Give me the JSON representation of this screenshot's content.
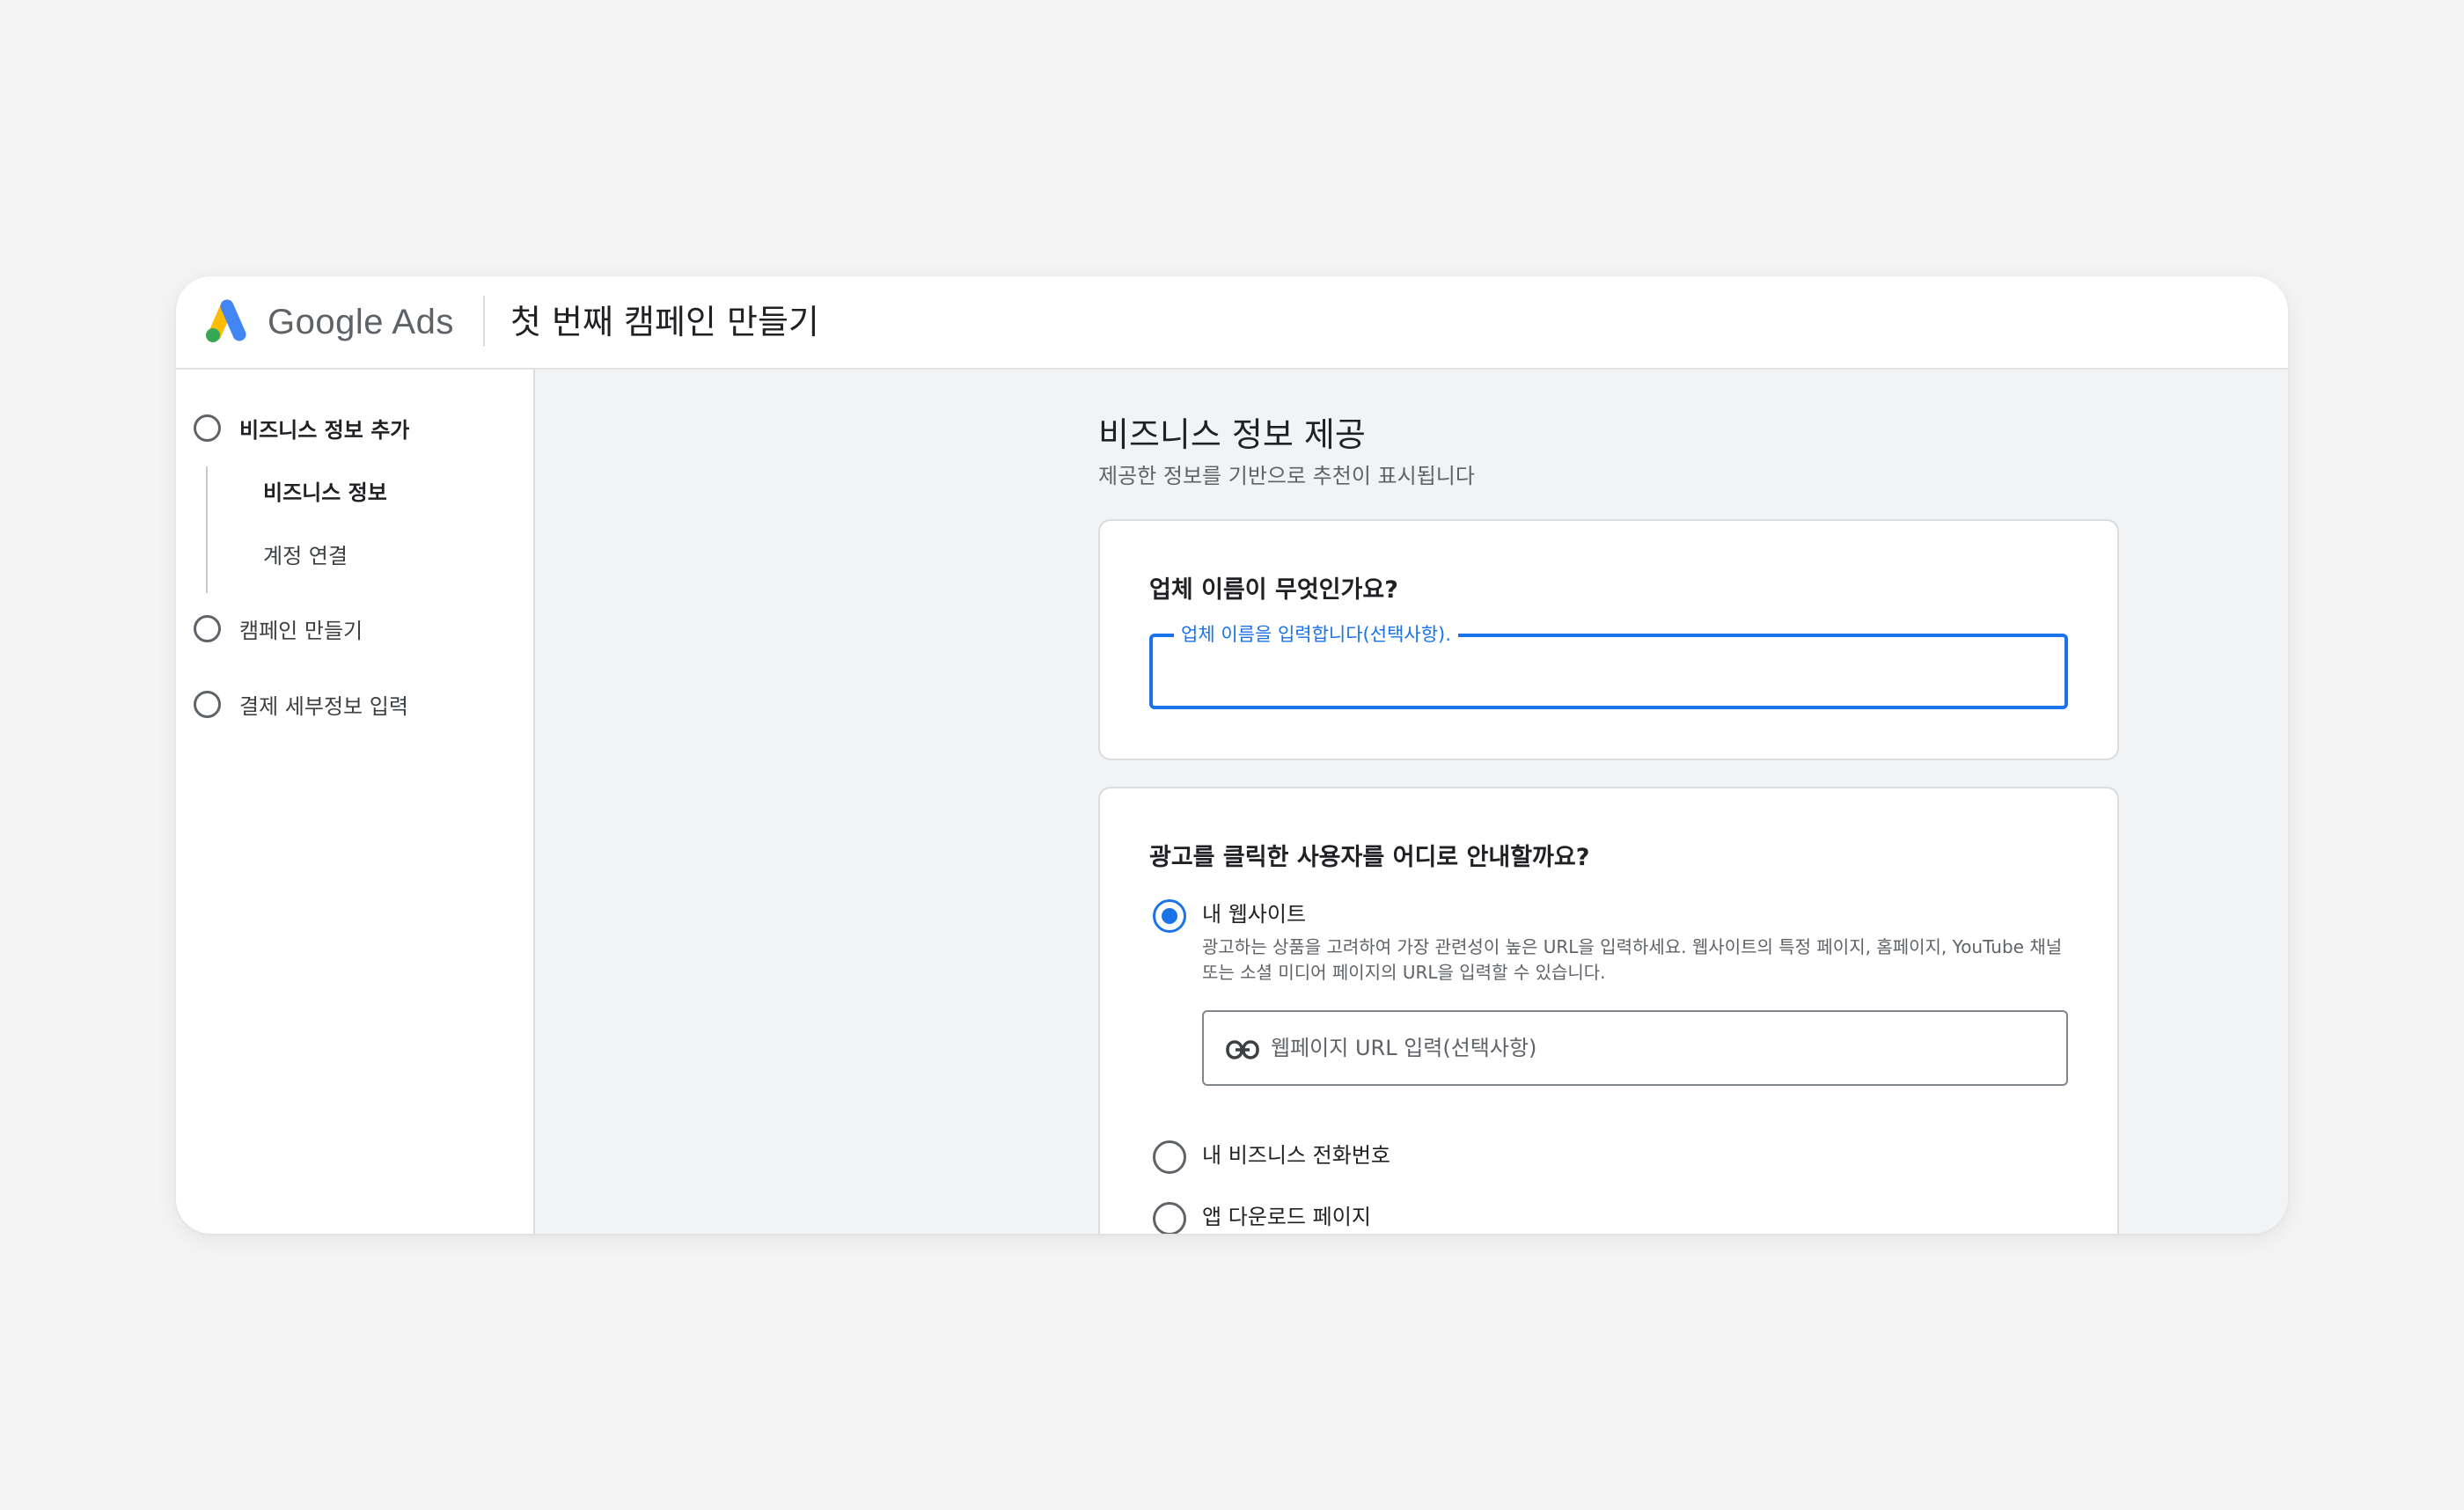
{
  "header": {
    "brand": "Google Ads",
    "title": "첫 번째 캠페인 만들기"
  },
  "sidebar": {
    "steps": [
      {
        "label": "비즈니스 정보 추가",
        "active": true
      },
      {
        "label": "캠페인 만들기",
        "active": false
      },
      {
        "label": "결제 세부정보 입력",
        "active": false
      }
    ],
    "substeps": [
      {
        "label": "비즈니스 정보",
        "active": true
      },
      {
        "label": "계정 연결",
        "active": false
      }
    ]
  },
  "main": {
    "title": "비즈니스 정보 제공",
    "subtitle": "제공한 정보를 기반으로 추천이 표시됩니다",
    "business_name": {
      "question": "업체 이름이 무엇인가요?",
      "field_label": "업체 이름을 입력합니다(선택사항).",
      "value": ""
    },
    "destination": {
      "question": "광고를 클릭한 사용자를 어디로 안내할까요?",
      "options": [
        {
          "label": "내 웹사이트",
          "selected": true,
          "description": "광고하는 상품을 고려하여 가장 관련성이 높은 URL을 입력하세요. 웹사이트의 특정 페이지, 홈페이지, YouTube 채널 또는 소셜 미디어 페이지의 URL을 입력할 수 있습니다."
        },
        {
          "label": "내 비즈니스 전화번호",
          "selected": false
        },
        {
          "label": "앱 다운로드 페이지",
          "selected": false
        }
      ],
      "url_placeholder": "웹페이지 URL 입력(선택사항)"
    }
  },
  "icons": {
    "logo": "google-ads-logo",
    "link": "link-icon",
    "step": "step-circle-icon",
    "radio": "radio-icon"
  },
  "colors": {
    "accent": "#1a73e8",
    "logo_blue": "#4285f4",
    "logo_yellow": "#fbbc04",
    "logo_green": "#34a853"
  }
}
